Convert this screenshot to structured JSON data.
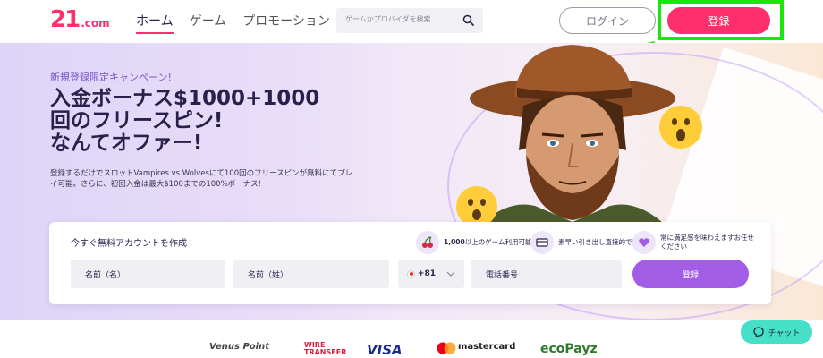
{
  "header": {
    "logo": "21",
    "logo_domain": ".com",
    "nav": [
      "ホーム",
      "ゲーム",
      "プロモーション"
    ],
    "search_placeholder": "ゲームかプロバイダを検索",
    "login_label": "ログイン",
    "register_label": "登録"
  },
  "hero": {
    "campaign": "新規登録限定キャンペーン!",
    "headline": [
      "入金ボーナス$1000+1000",
      "回のフリースピン!",
      "なんてオファー!"
    ],
    "description": "登録するだけでスロットVampires vs Wolvesにて100回のフリースピンが無料にてプレイ可能。さらに、初回入金は最大$100までの100%ボーナス!"
  },
  "form": {
    "title": "今すぐ無料アカウントを作成",
    "features": [
      {
        "icon": "cherries-icon",
        "text_bold": "1,000",
        "text": "以上のゲーム利用可能"
      },
      {
        "icon": "card-icon",
        "text_bold": "",
        "text": "素早い引き出し直接的で安全"
      },
      {
        "icon": "heart-icon",
        "text_bold": "",
        "text": "常に満足感を味わえますお任せください"
      }
    ],
    "first_name_placeholder": "名前（名）",
    "last_name_placeholder": "名前（姓）",
    "phone_code": "+81",
    "phone_placeholder": "電話番号",
    "submit_label": "登録"
  },
  "payments": {
    "items": [
      "Venus Point",
      "WIRE TRANSFER",
      "VISA",
      "mastercard",
      "ecoPayz"
    ]
  },
  "chat": {
    "label": "チャット"
  },
  "colors": {
    "brand": "#ff2e6c",
    "accent_purple": "#a35ce6",
    "highlight_green": "#19e60c",
    "chat_teal": "#46e0c8"
  }
}
